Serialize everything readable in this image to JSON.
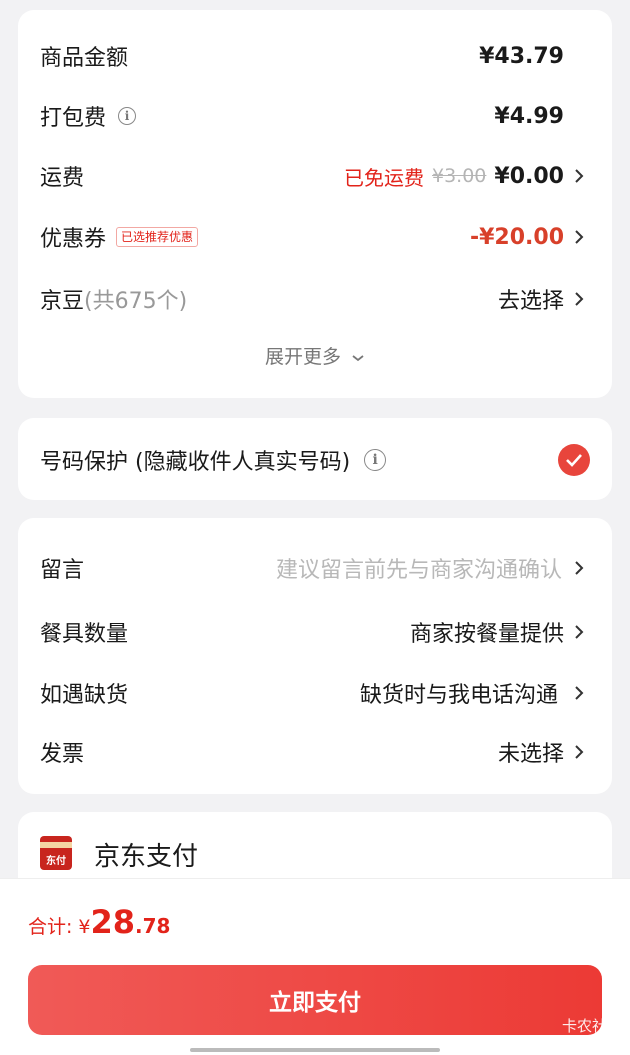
{
  "fees": {
    "goods": {
      "label": "商品金额",
      "value": "¥43.79"
    },
    "packing": {
      "label": "打包费",
      "value": "¥4.99"
    },
    "shipping": {
      "label": "运费",
      "free_text": "已免运费",
      "original": "¥3.00",
      "value": "¥0.00"
    },
    "coupon": {
      "label": "优惠券",
      "tag": "已选推荐优惠",
      "value": "-¥20.00"
    },
    "beans": {
      "label": "京豆",
      "count": "(共675个)",
      "value": "去选择"
    },
    "expand": "展开更多"
  },
  "privacy": {
    "label": "号码保护 (隐藏收件人真实号码)"
  },
  "extras": {
    "message": {
      "label": "留言",
      "placeholder": "建议留言前先与商家沟通确认"
    },
    "tableware": {
      "label": "餐具数量",
      "value": "商家按餐量提供"
    },
    "shortage": {
      "label": "如遇缺货",
      "value": "缺货时与我电话沟通"
    },
    "invoice": {
      "label": "发票",
      "value": "未选择"
    }
  },
  "payment": {
    "logo_text": "东付",
    "method": "京东支付"
  },
  "footer": {
    "total_label": "合计:",
    "currency": "¥",
    "total_int": "28",
    "total_dec": ".78",
    "pay_button": "立即支付",
    "watermark": "卡农社区"
  },
  "colors": {
    "accent": "#e2231a",
    "button": "#ec3a35"
  },
  "icons": [
    "info-icon",
    "chevron-right-icon",
    "chevron-down-icon",
    "check-icon",
    "jd-pay-icon"
  ]
}
